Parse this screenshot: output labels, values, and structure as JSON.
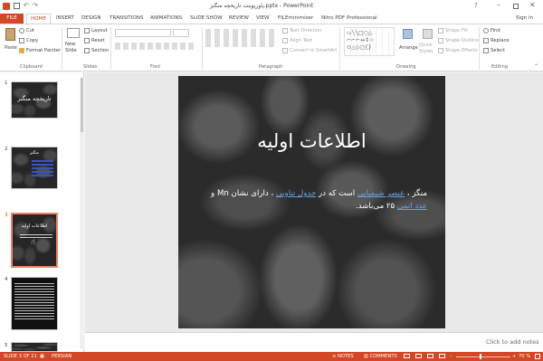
{
  "window": {
    "title": "پاورپوینت تاریخچه منگنز.pptx - PowerPoint",
    "sign_in": "Sign in"
  },
  "tabs": [
    "FILE",
    "HOME",
    "INSERT",
    "DESIGN",
    "TRANSITIONS",
    "ANIMATIONS",
    "SLIDE SHOW",
    "REVIEW",
    "VIEW",
    "FILEminimizer",
    "Nitro PDF Professional"
  ],
  "ribbon": {
    "clipboard": {
      "paste": "Paste",
      "cut": "Cut",
      "copy": "Copy",
      "format_painter": "Format Painter",
      "label": "Clipboard"
    },
    "slides": {
      "new_slide": "New Slide",
      "layout": "Layout",
      "reset": "Reset",
      "section": "Section",
      "label": "Slides"
    },
    "font": {
      "label": "Font"
    },
    "paragraph": {
      "text_direction": "Text Direction",
      "align_text": "Align Text",
      "convert_smartart": "Convert to SmartArt",
      "label": "Paragraph"
    },
    "drawing": {
      "arrange": "Arrange",
      "quick_styles": "Quick Styles",
      "shape_fill": "Shape Fill",
      "shape_outline": "Shape Outline",
      "shape_effects": "Shape Effects",
      "label": "Drawing"
    },
    "editing": {
      "find": "Find",
      "replace": "Replace",
      "select": "Select",
      "label": "Editing"
    }
  },
  "thumbnails": [
    {
      "num": "1",
      "title": "تاریخچه منگنز"
    },
    {
      "num": "2",
      "title": "منگنز"
    },
    {
      "num": "3",
      "title": "اطلاعات اولیه"
    },
    {
      "num": "4",
      "title": ""
    },
    {
      "num": "5",
      "title": ""
    }
  ],
  "slide": {
    "title": "اطلاعات اولیه",
    "body_prefix": "منگز ، ",
    "link1": "عنصر شیمیایی",
    "body_mid1": " است که در ",
    "link2": "جدول تناوبی",
    "body_mid2": " ، دارای نشان ",
    "symbol": "Mn",
    "body_mid3": " و ",
    "link3": "عدد اتمی",
    "body_end": " ۲۵ می‌باشد."
  },
  "notes_placeholder": "Click to add notes",
  "status": {
    "slide_info": "SLIDE 3 OF 21",
    "language": "PERSIAN",
    "notes": "NOTES",
    "comments": "COMMENTS",
    "zoom": "70 %"
  },
  "colors": {
    "accent": "#d24726"
  }
}
